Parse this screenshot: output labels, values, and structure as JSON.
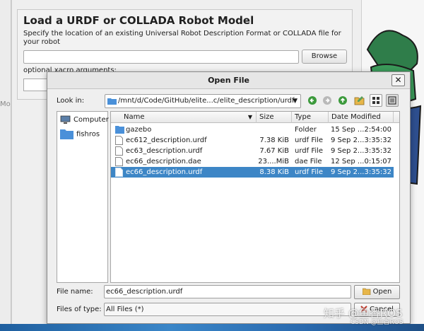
{
  "background": {
    "left_label": "Mo",
    "group_title": "Load a URDF or COLLADA Robot Model",
    "group_description": "Specify the location of an existing Universal Robot Description Format or COLLADA file for your robot",
    "browse_label": "Browse",
    "xacro_label": "optional xacro arguments:"
  },
  "dialog": {
    "title": "Open File",
    "close_symbol": "✕",
    "look_in_label": "Look in:",
    "look_in_path": "/mnt/d/Code/GitHub/elite...c/elite_description/urdf",
    "sidebar": [
      {
        "label": "Computer",
        "icon": "computer-icon"
      },
      {
        "label": "fishros",
        "icon": "folder-icon"
      }
    ],
    "columns": {
      "name": "Name",
      "size": "Size",
      "type": "Type",
      "date": "Date Modified"
    },
    "files": [
      {
        "name": "gazebo",
        "size": "",
        "type": "Folder",
        "date": "15 Sep ...2:54:00",
        "icon": "folder-icon",
        "selected": false
      },
      {
        "name": "ec612_description.urdf",
        "size": "7.38 KiB",
        "type": "urdf File",
        "date": "9 Sep 2...3:35:32",
        "icon": "file-icon",
        "selected": false
      },
      {
        "name": "ec63_description.urdf",
        "size": "7.67 KiB",
        "type": "urdf File",
        "date": "9 Sep 2...3:35:32",
        "icon": "file-icon",
        "selected": false
      },
      {
        "name": "ec66_description.dae",
        "size": "23....MiB",
        "type": "dae File",
        "date": "12 Sep ...0:15:07",
        "icon": "file-icon",
        "selected": false
      },
      {
        "name": "ec66_description.urdf",
        "size": "8.38 KiB",
        "type": "urdf File",
        "date": "9 Sep 2...3:35:32",
        "icon": "file-icon",
        "selected": true
      }
    ],
    "file_name_label": "File name:",
    "file_name_value": "ec66_description.urdf",
    "files_of_type_label": "Files of type:",
    "files_of_type_value": "All Files (*)",
    "open_label": "Open",
    "cancel_label": "Cancel"
  },
  "watermark": {
    "main": "知乎 @鱼香ROS",
    "sub": "CSDN @鱼香ROS"
  },
  "colors": {
    "selection": "#3d86c6",
    "folder": "#4a90d9",
    "accent_green": "#3c9a3c"
  }
}
